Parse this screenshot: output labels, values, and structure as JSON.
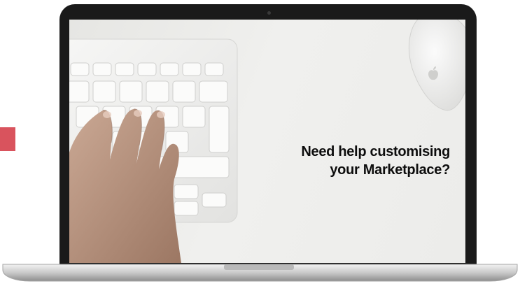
{
  "banner": {
    "headline_line1": "Need help customising",
    "headline_line2": "your Marketplace?"
  },
  "icons": {
    "mouse_logo": "apple-logo-icon"
  },
  "colors": {
    "accent": "#d9535d",
    "bezel": "#1a1a1a",
    "headline": "#0d0d0d"
  }
}
